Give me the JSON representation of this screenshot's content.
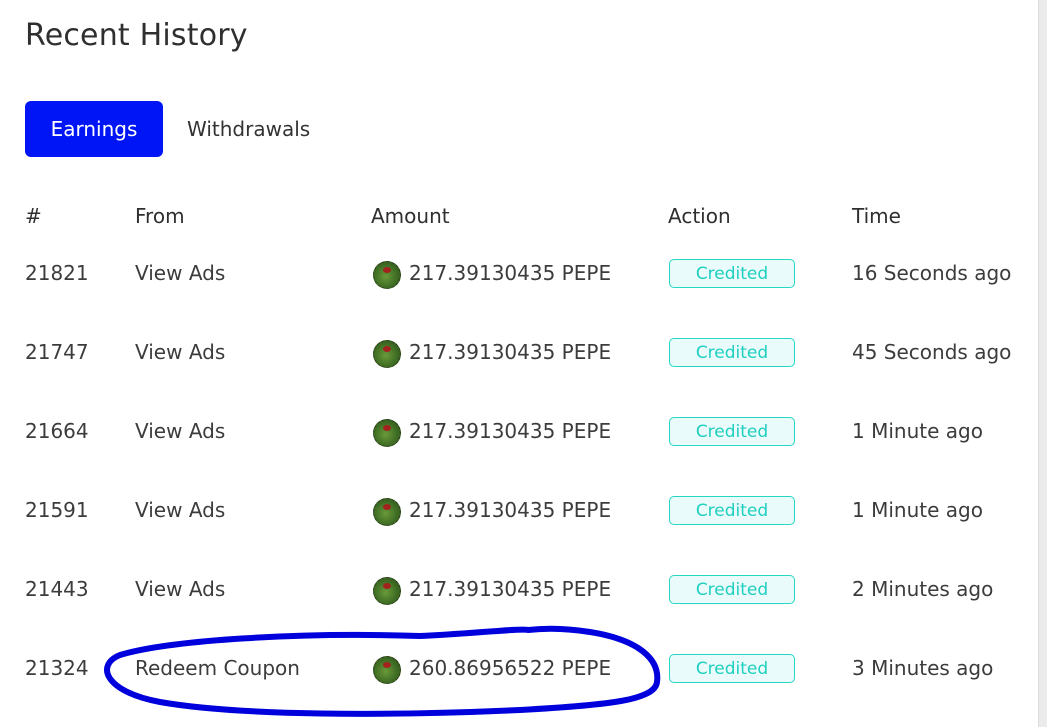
{
  "page": {
    "title": "Recent History"
  },
  "tabs": [
    {
      "label": "Earnings",
      "active": true
    },
    {
      "label": "Withdrawals",
      "active": false
    }
  ],
  "table": {
    "columns": [
      "#",
      "From",
      "Amount",
      "Action",
      "Time"
    ],
    "rows": [
      {
        "id": "21821",
        "from": "View Ads",
        "amount": "217.39130435 PEPE",
        "action": "Credited",
        "time": "16 Seconds ago"
      },
      {
        "id": "21747",
        "from": "View Ads",
        "amount": "217.39130435 PEPE",
        "action": "Credited",
        "time": "45 Seconds ago"
      },
      {
        "id": "21664",
        "from": "View Ads",
        "amount": "217.39130435 PEPE",
        "action": "Credited",
        "time": "1 Minute ago"
      },
      {
        "id": "21591",
        "from": "View Ads",
        "amount": "217.39130435 PEPE",
        "action": "Credited",
        "time": "1 Minute ago"
      },
      {
        "id": "21443",
        "from": "View Ads",
        "amount": "217.39130435 PEPE",
        "action": "Credited",
        "time": "2 Minutes ago"
      },
      {
        "id": "21324",
        "from": "Redeem Coupon",
        "amount": "260.86956522 PEPE",
        "action": "Credited",
        "time": "3 Minutes ago"
      }
    ]
  },
  "icons": {
    "coin": "pepe-coin-icon"
  },
  "colors": {
    "accent": "#0015f5",
    "badge_text": "#1fcfc0",
    "badge_border": "#25d7c7",
    "annotation": "#0000dd"
  }
}
